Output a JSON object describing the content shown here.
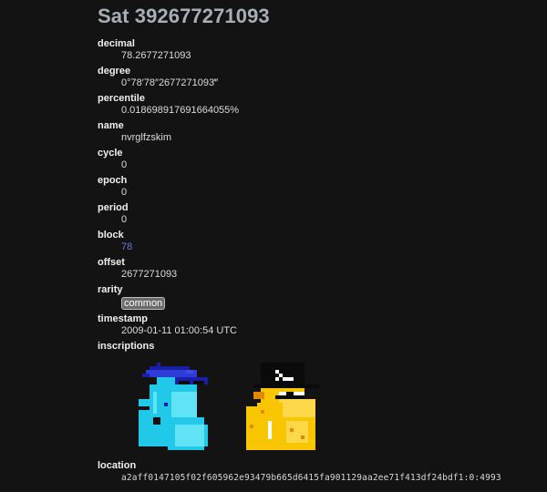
{
  "page": {
    "title": "Sat 392677271093"
  },
  "properties": [
    {
      "key": "decimal",
      "label": "decimal",
      "value": "78.2677271093"
    },
    {
      "key": "degree",
      "label": "degree",
      "value": "0°78′78″2677271093‴"
    },
    {
      "key": "percentile",
      "label": "percentile",
      "value": "0.018698917691664055%"
    },
    {
      "key": "name",
      "label": "name",
      "value": "nvrglfzskim"
    },
    {
      "key": "cycle",
      "label": "cycle",
      "value": "0"
    },
    {
      "key": "epoch",
      "label": "epoch",
      "value": "0"
    },
    {
      "key": "period",
      "label": "period",
      "value": "0"
    },
    {
      "key": "block",
      "label": "block",
      "value": "78"
    },
    {
      "key": "offset",
      "label": "offset",
      "value": "2677271093"
    },
    {
      "key": "rarity",
      "label": "rarity",
      "value": "common"
    },
    {
      "key": "timestamp",
      "label": "timestamp",
      "value": "2009-01-11 01:00:54 UTC"
    }
  ],
  "inscriptions": {
    "label": "inscriptions",
    "items": [
      {
        "name": "inscription-thumbnail-blue-character",
        "palette": [
          "#1a1fa8",
          "#2f3bd6",
          "#22c8e8",
          "#5fe3f5",
          "#0d0d0d"
        ]
      },
      {
        "name": "inscription-thumbnail-yellow-character",
        "palette": [
          "#0a0a0a",
          "#ffffff",
          "#f7c600",
          "#ffd84a",
          "#e08a00"
        ]
      }
    ]
  },
  "location": {
    "label": "location",
    "value": "a2aff0147105f02f605962e93479b665d6415fa901129aa2ee71f413df24bdf1:0:4993"
  },
  "colors": {
    "background": "#131313",
    "title": "#a8adb6",
    "link": "#6f75d8",
    "badge": "#6b6b6b"
  }
}
